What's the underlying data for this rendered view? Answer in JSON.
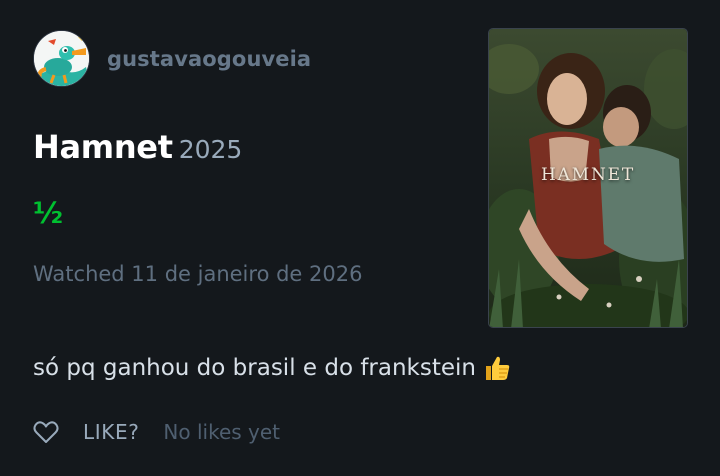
{
  "user": {
    "username": "gustavaogouveia",
    "avatar_icon": "cartoon-platypus-avatar"
  },
  "film": {
    "title": "Hamnet",
    "year": "2025",
    "rating": "½",
    "watched_text": "Watched 11 de janeiro de 2026",
    "poster_title": "HAMNET"
  },
  "review": {
    "text": "só pq ganhou do brasil e do frankstein",
    "emoji": "thumbs-up-icon"
  },
  "likes": {
    "label": "LIKE?",
    "count_text": "No likes yet",
    "icon": "heart-outline-icon"
  },
  "colors": {
    "background": "#14181c",
    "rating_green": "#00c030",
    "title_white": "#ffffff",
    "muted": "#67788a"
  }
}
